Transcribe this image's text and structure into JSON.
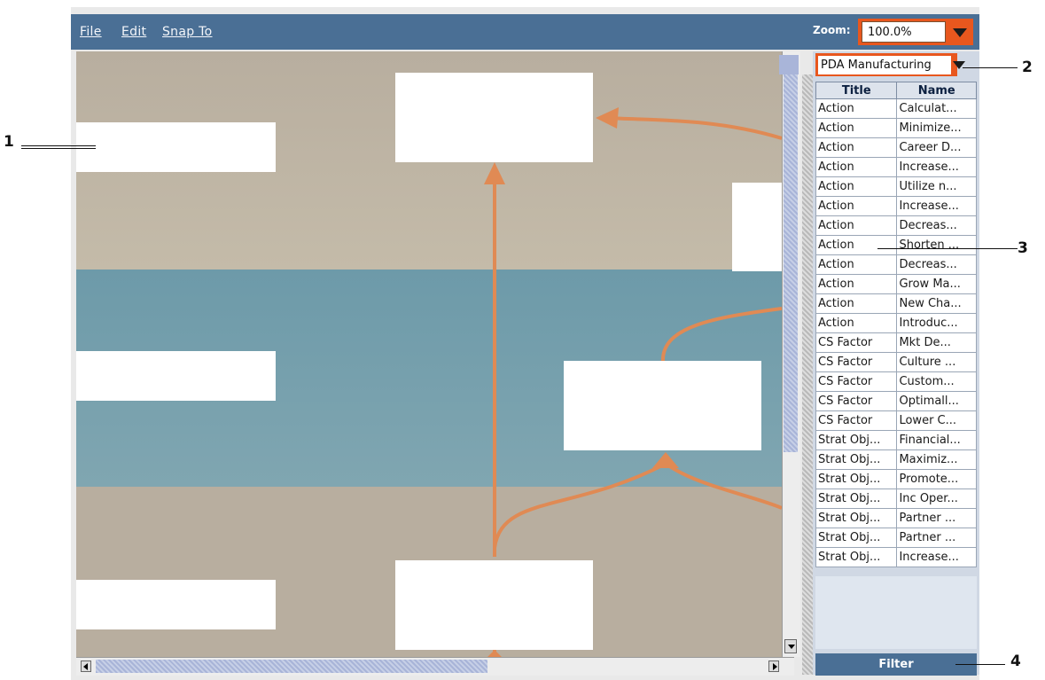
{
  "menubar": {
    "items": [
      "File",
      "Edit",
      "Snap To"
    ]
  },
  "zoom": {
    "label": "Zoom:",
    "value": "100.0%"
  },
  "project_select": {
    "value": "PDA Manufacturing"
  },
  "table": {
    "columns": [
      "Title",
      "Name"
    ],
    "rows": [
      [
        "Action",
        "Calculat..."
      ],
      [
        "Action",
        "Minimize..."
      ],
      [
        "Action",
        "Career D..."
      ],
      [
        "Action",
        "Increase..."
      ],
      [
        "Action",
        "Utilize n..."
      ],
      [
        "Action",
        "Increase..."
      ],
      [
        "Action",
        "Decreas..."
      ],
      [
        "Action",
        "Shorten ..."
      ],
      [
        "Action",
        "Decreas..."
      ],
      [
        "Action",
        "Grow Ma..."
      ],
      [
        "Action",
        "New Cha..."
      ],
      [
        "Action",
        "Introduc..."
      ],
      [
        "CS Factor",
        "Mkt De..."
      ],
      [
        "CS Factor",
        "Culture ..."
      ],
      [
        "CS Factor",
        "Custom..."
      ],
      [
        "CS Factor",
        "Optimall..."
      ],
      [
        "CS Factor",
        "Lower C..."
      ],
      [
        "Strat Obj...",
        "Financial..."
      ],
      [
        "Strat Obj...",
        "Maximiz..."
      ],
      [
        "Strat Obj...",
        "Promote..."
      ],
      [
        "Strat Obj...",
        "Inc Oper..."
      ],
      [
        "Strat Obj...",
        "Partner ..."
      ],
      [
        "Strat Obj...",
        "Partner ..."
      ],
      [
        "Strat Obj...",
        "Increase..."
      ]
    ]
  },
  "filter_button": {
    "label": "Filter"
  },
  "callouts": [
    "1",
    "2",
    "3",
    "4"
  ],
  "colors": {
    "menubar": "#4a6f95",
    "accent_orange": "#e8571e",
    "arrow_orange": "#e08a54",
    "band_tan": "#b8ae9f",
    "band_teal": "#6d9aa9"
  }
}
